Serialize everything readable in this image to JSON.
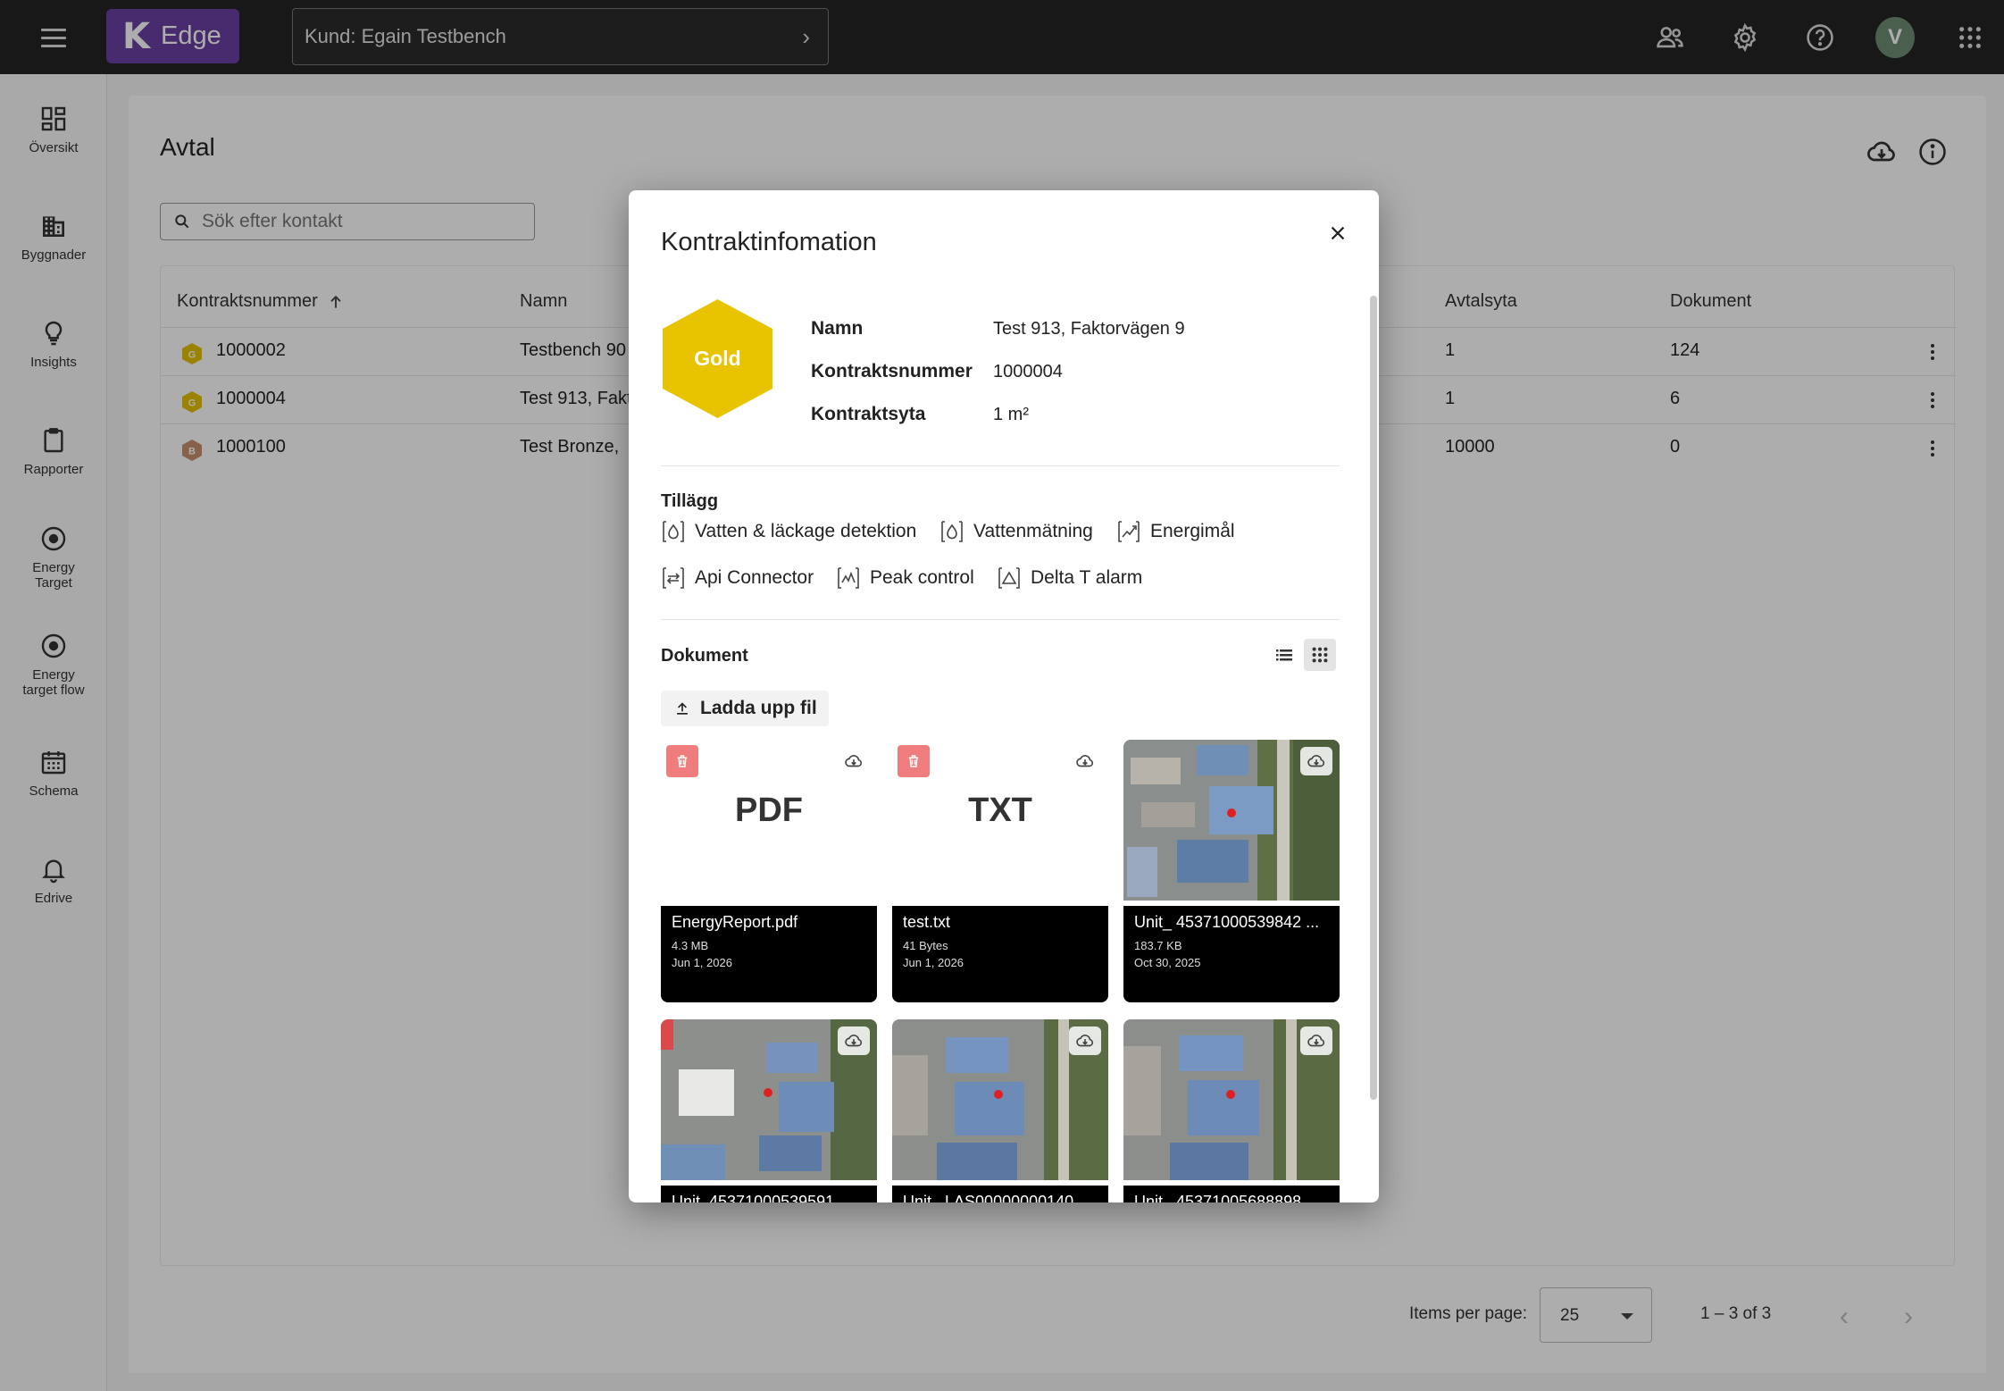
{
  "header": {
    "brand_letter": "K",
    "brand_name": "Edge",
    "customer_label": "Kund: Egain Testbench",
    "user_initial": "V",
    "icons": [
      "menu-icon",
      "users-icon",
      "gear-icon",
      "help-icon",
      "apps-grid-icon"
    ]
  },
  "sidebar": {
    "items": [
      {
        "label": "Översikt",
        "icon": "dashboard-icon"
      },
      {
        "label": "Byggnader",
        "icon": "building-icon"
      },
      {
        "label": "Insights",
        "icon": "lightbulb-icon"
      },
      {
        "label": "Rapporter",
        "icon": "clipboard-icon"
      },
      {
        "label": "Energy Target",
        "icon": "target-icon"
      },
      {
        "label": "Energy target flow",
        "icon": "target-icon"
      },
      {
        "label": "Schema",
        "icon": "calendar-icon"
      },
      {
        "label": "Edrive",
        "icon": "bell-icon"
      }
    ]
  },
  "page": {
    "title": "Avtal",
    "search_placeholder": "Sök efter kontakt",
    "columns": [
      "Kontraktsnummer",
      "Namn",
      "Avtalsyta",
      "Dokument"
    ],
    "rows": [
      {
        "badge": "G",
        "tier_color": "#e5c100",
        "number": "1000002",
        "name": "Testbench 90",
        "area": "1",
        "docs": "124"
      },
      {
        "badge": "G",
        "tier_color": "#e5c100",
        "number": "1000004",
        "name": "Test 913, Fakt",
        "area": "1",
        "docs": "6"
      },
      {
        "badge": "B",
        "tier_color": "#c98f6e",
        "number": "1000100",
        "name": "Test Bronze,",
        "area": "10000",
        "docs": "0"
      }
    ],
    "pager": {
      "items_per_page_label": "Items per page:",
      "items_per_page": "25",
      "range": "1 – 3 of 3"
    }
  },
  "modal": {
    "title": "Kontraktinfomation",
    "tier": "Gold",
    "tier_color": "#e8c400",
    "fields": [
      {
        "label": "Namn",
        "value": "Test 913, Faktorvägen 9"
      },
      {
        "label": "Kontraktsnummer",
        "value": "1000004"
      },
      {
        "label": "Kontraktsyta",
        "value": "1 m²"
      }
    ],
    "addons_title": "Tillägg",
    "addons": [
      {
        "label": "Vatten & läckage detektion",
        "icon": "water-drop-icon"
      },
      {
        "label": "Vattenmätning",
        "icon": "water-drop-icon"
      },
      {
        "label": "Energimål",
        "icon": "energy-graph-icon"
      },
      {
        "label": "Api Connector",
        "icon": "api-connector-icon"
      },
      {
        "label": "Peak control",
        "icon": "peak-graph-icon"
      },
      {
        "label": "Delta T alarm",
        "icon": "delta-alarm-icon"
      }
    ],
    "documents_title": "Dokument",
    "upload_label": "Ladda upp fil",
    "files": [
      {
        "type": "PDF",
        "name": "EnergyReport.pdf",
        "size": "4.3 MB",
        "date": "Jun 1, 2026"
      },
      {
        "type": "TXT",
        "name": "test.txt",
        "size": "41 Bytes",
        "date": "Jun 1, 2026"
      },
      {
        "type": "image",
        "name": "Unit_ 45371000539842 ...",
        "size": "183.7 KB",
        "date": "Oct 30, 2025"
      },
      {
        "type": "image",
        "name": "Unit_45371000539591",
        "size": "",
        "date": ""
      },
      {
        "type": "image",
        "name": "Unit_ LAS00000000140",
        "size": "",
        "date": ""
      },
      {
        "type": "image",
        "name": "Unit_ 45371005688898",
        "size": "",
        "date": ""
      }
    ]
  }
}
